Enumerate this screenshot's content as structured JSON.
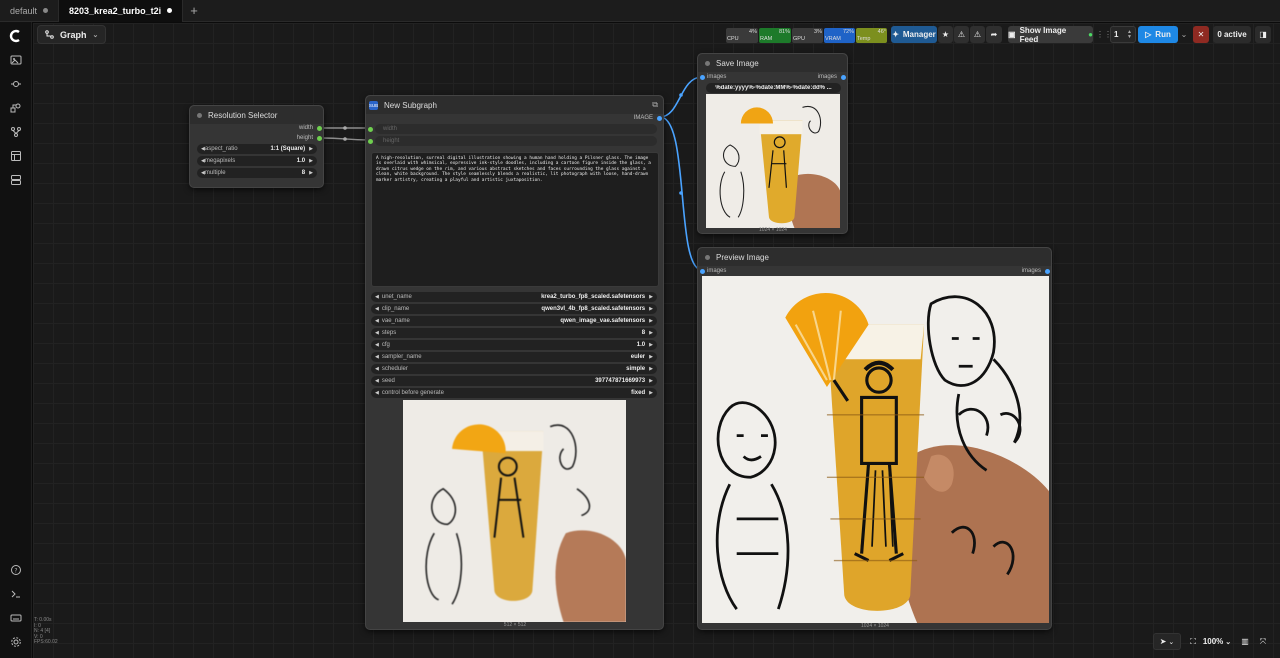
{
  "tabs": [
    {
      "label": "default",
      "active": false
    },
    {
      "label": "8203_krea2_turbo_t2i",
      "active": true
    }
  ],
  "toolbar": {
    "graph_label": "Graph",
    "meters": [
      {
        "name": "CPU",
        "value": "4%",
        "color": "#3a3a3a"
      },
      {
        "name": "RAM",
        "value": "81%",
        "color": "#1d7a2a"
      },
      {
        "name": "GPU",
        "value": "3%",
        "color": "#3a3a3a"
      },
      {
        "name": "VRAM",
        "value": "72%",
        "color": "#1f63c7"
      },
      {
        "name": "Temp",
        "value": "46°",
        "color": "#7c8f1e"
      }
    ],
    "manager_label": "Manager",
    "show_feed_label": "Show Image Feed",
    "batch_count": "1",
    "run_label": "Run",
    "active_label": "0 active"
  },
  "nodes": {
    "resolution": {
      "title": "Resolution Selector",
      "outputs": [
        "width",
        "height"
      ],
      "widgets": [
        {
          "name": "aspect_ratio",
          "value": "1:1 (Square)"
        },
        {
          "name": "megapixels",
          "value": "1.0"
        },
        {
          "name": "multiple",
          "value": "8"
        }
      ]
    },
    "subgraph": {
      "title": "New Subgraph",
      "badge": "SUB",
      "output": "IMAGE",
      "inputs": [
        "width",
        "height"
      ],
      "prompt": "A high-resolution, surreal digital illustration showing a human hand holding a Pilsner glass. The image is overlaid with whimsical, expressive ink-style doodles, including a cartoon figure inside the glass, a drawn citrus wedge on the rim, and various abstract sketches and faces surrounding the glass against a clean, white background. The style seamlessly blends a realistic, lit photograph with loose, hand-drawn marker artistry, creating a playful and artistic juxtaposition.",
      "widgets": [
        {
          "name": "unet_name",
          "value": "krea2_turbo_fp8_scaled.safetensors"
        },
        {
          "name": "clip_name",
          "value": "qwen3vl_4b_fp8_scaled.safetensors"
        },
        {
          "name": "vae_name",
          "value": "qwen_image_vae.safetensors"
        },
        {
          "name": "steps",
          "value": "8"
        },
        {
          "name": "cfg",
          "value": "1.0"
        },
        {
          "name": "sampler_name",
          "value": "euler"
        },
        {
          "name": "scheduler",
          "value": "simple"
        },
        {
          "name": "seed",
          "value": "397747871669973"
        },
        {
          "name": "control before generate",
          "value": "fixed"
        }
      ],
      "image_size": "512 × 512"
    },
    "save": {
      "title": "Save Image",
      "input": "images",
      "output": "images",
      "filename": "%date:yyyy%-%date:MM%-%date:dd% ...",
      "image_size": "1024 × 1024"
    },
    "preview": {
      "title": "Preview Image",
      "input": "images",
      "output": "images",
      "image_size": "1024 × 1024"
    }
  },
  "stats": [
    "T: 0.00s",
    "I: 0",
    "N: 4 [4]",
    "V: 0",
    "FPS:60.02"
  ],
  "bottom": {
    "zoom": "100%"
  },
  "colors": {
    "accent": "#2a8cf0",
    "link_blue": "#4aa3ff",
    "link_green": "#6fcf4f",
    "run": "#1e88e5",
    "cancel": "#c0392b"
  }
}
